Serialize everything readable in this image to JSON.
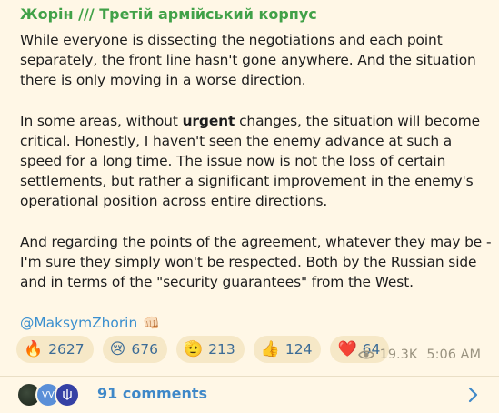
{
  "post": {
    "channel": "Жорін /// Третій армійський корпус",
    "para1": "While everyone is dissecting the negotiations and each point separately, the front line hasn't gone anywhere. And the situation there is only moving in a worse direction.",
    "para2_before": "In some areas, without ",
    "para2_bold": "urgent",
    "para2_after": " changes, the situation will become critical. Honestly, I haven't seen the enemy advance at such a speed for a long time. The issue now is not the loss of certain settlements, but rather a significant improvement in the enemy's operational position across entire directions.",
    "para3": "And regarding the points of the agreement, whatever they may be - I'm sure they simply won't be respected. Both by the Russian side and in terms of the \"security guarantees\" from the West.",
    "signature": "@MaksymZhorin",
    "signature_emoji": "👊🏻"
  },
  "reactions": [
    {
      "emoji": "🔥",
      "icon": "fire-icon",
      "count": "2627"
    },
    {
      "emoji": "😢",
      "icon": "crying-face-icon",
      "count": "676"
    },
    {
      "emoji": "🫡",
      "icon": "salute-icon",
      "count": "213"
    },
    {
      "emoji": "👍",
      "icon": "thumbs-up-icon",
      "count": "124"
    },
    {
      "emoji": "❤️",
      "icon": "heart-icon",
      "count": "64"
    }
  ],
  "meta": {
    "views": "19.3K",
    "time": "5:06 AM"
  },
  "footer": {
    "comments": "91 comments",
    "avatar2_text": "VV"
  },
  "colors": {
    "channel": "#41a148",
    "link": "#3a8fcf",
    "bubble": "#fff7e6",
    "reaction_bg": "#f6e8c7"
  }
}
